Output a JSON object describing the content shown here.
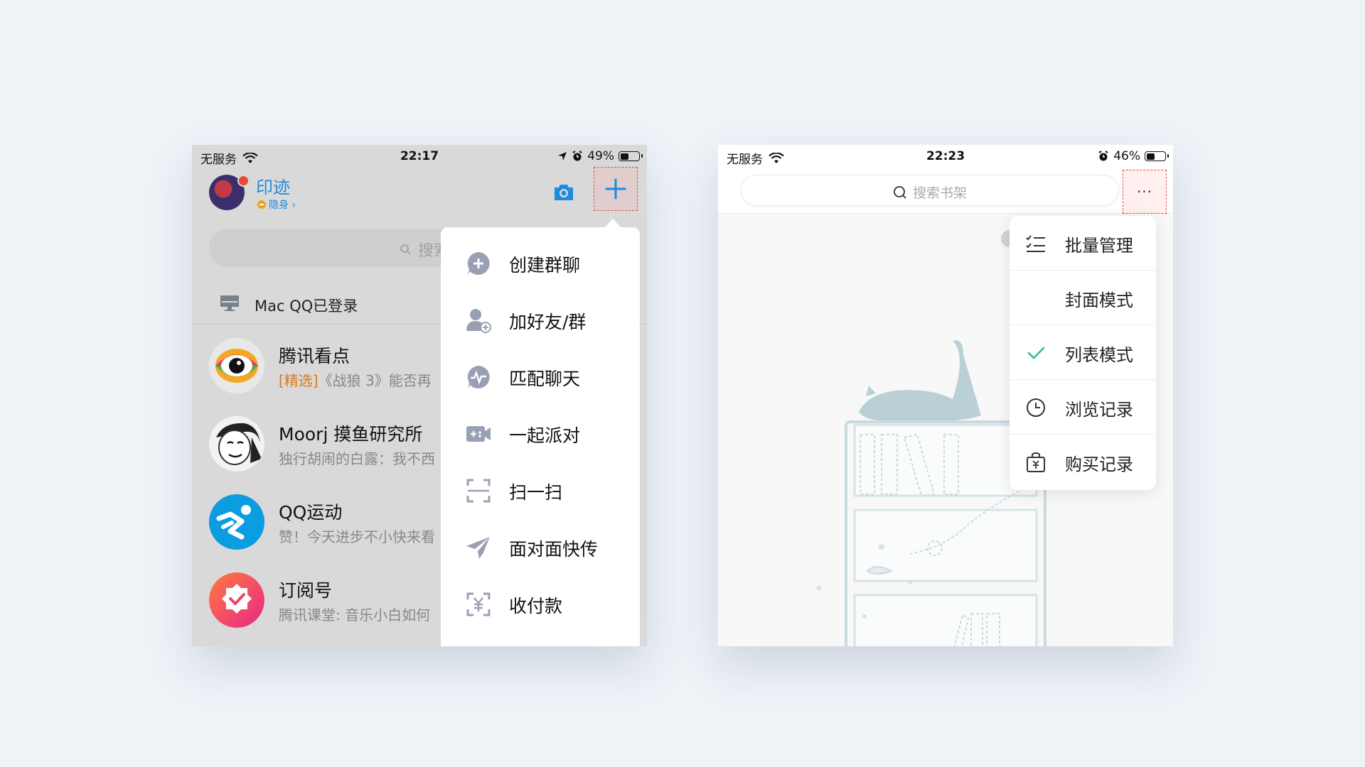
{
  "left_phone": {
    "status": {
      "carrier": "无服务",
      "time": "22:17",
      "battery": "49%",
      "battery_level": 0.49
    },
    "header": {
      "name": "印迹",
      "status": "隐身 ›"
    },
    "search": {
      "placeholder": "搜索"
    },
    "device_login": "Mac QQ已登录",
    "chats": [
      {
        "title": "腾讯看点",
        "tag": "[精选]",
        "preview": "《战狼 3》能否再"
      },
      {
        "title": "Moorj 摸鱼研究所",
        "tag": "",
        "preview": "独行胡闹的白露：我不西"
      },
      {
        "title": "QQ运动",
        "tag": "",
        "preview": "赞！今天进步不小快来看"
      },
      {
        "title": "订阅号",
        "tag": "",
        "preview": "腾讯课堂: 音乐小白如何"
      }
    ],
    "plus_menu": [
      {
        "label": "创建群聊",
        "icon": "add-circle-icon"
      },
      {
        "label": "加好友/群",
        "icon": "add-friend-icon"
      },
      {
        "label": "匹配聊天",
        "icon": "match-chat-icon"
      },
      {
        "label": "一起派对",
        "icon": "party-icon"
      },
      {
        "label": "扫一扫",
        "icon": "scan-icon"
      },
      {
        "label": "面对面快传",
        "icon": "paper-plane-icon"
      },
      {
        "label": "收付款",
        "icon": "payment-icon"
      }
    ],
    "accent_color": "#1c8ce0"
  },
  "right_phone": {
    "status": {
      "carrier": "无服务",
      "time": "22:23",
      "battery": "46%",
      "battery_level": 0.46
    },
    "search": {
      "placeholder": "搜索书架"
    },
    "more_button": "···",
    "more_menu": [
      {
        "label": "批量管理",
        "icon": "checklist-icon",
        "checked": false
      },
      {
        "label": "封面模式",
        "icon": "",
        "checked": false
      },
      {
        "label": "列表模式",
        "icon": "check-icon",
        "checked": true
      },
      {
        "label": "浏览记录",
        "icon": "clock-icon",
        "checked": false
      },
      {
        "label": "购买记录",
        "icon": "purchase-bag-icon",
        "checked": false
      }
    ],
    "check_color": "#3cc39a"
  }
}
